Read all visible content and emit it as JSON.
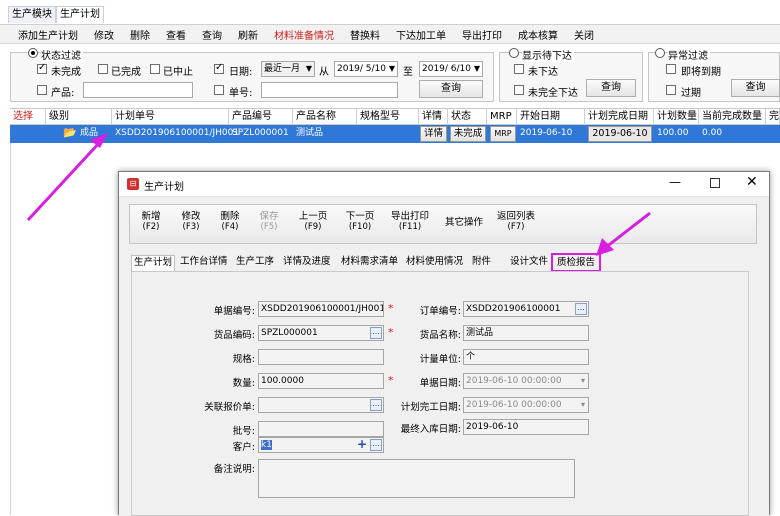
{
  "tabs": [
    "生产模块",
    "生产计划"
  ],
  "toolbar": [
    "添加生产计划",
    "修改",
    "删除",
    "查看",
    "查询",
    "刷新",
    "材料准备情况",
    "替换料",
    "下达加工单",
    "导出打印",
    "成本核算",
    "关闭"
  ],
  "colors": {
    "red_label": "#d0201e",
    "selected_row": "#2f78d7",
    "highlight": "#d81ee0"
  },
  "filter1": {
    "title": "状态过滤",
    "unfinished": "未完成",
    "finished": "已完成",
    "stopped": "已中止",
    "date_label": "日期:",
    "date_range": "最近一月",
    "from_label": "从",
    "from_date": "2019/ 5/10",
    "to_label": "至",
    "to_date": "2019/ 6/10",
    "product_label": "产品:",
    "order_label": "单号:",
    "query": "查询"
  },
  "filter2": {
    "title": "显示待下达",
    "not_issued": "未下达",
    "not_fully_issued": "未完全下达",
    "query": "查询"
  },
  "filter3": {
    "title": "异常过滤",
    "due_soon": "即将到期",
    "overdue": "过期",
    "query": "查询"
  },
  "grid": {
    "headers": [
      "选择",
      "级别",
      "计划单号",
      "产品编号",
      "产品名称",
      "规格型号",
      "详情",
      "状态",
      "MRP",
      "开始日期",
      "计划完成日期",
      "计划数量",
      "当前完成数量",
      "完"
    ],
    "row": {
      "level": "成品",
      "plan_no": "XSDD201906100001/JH001",
      "product_no": "SPZL000001",
      "product_name": "测试品",
      "detail": "详情",
      "status": "未完成",
      "mrp": "MRP",
      "start_date": "2019-06-10",
      "plan_finish_date": "2019-06-10",
      "plan_qty": "100.00",
      "current_qty": "0.00"
    }
  },
  "dialog": {
    "title": "生产计划",
    "tools": [
      {
        "label": "新增",
        "key": "(F2)"
      },
      {
        "label": "修改",
        "key": "(F3)"
      },
      {
        "label": "删除",
        "key": "(F4)"
      },
      {
        "label": "保存",
        "key": "(F5)"
      },
      {
        "label": "上一页",
        "key": "(F9)"
      },
      {
        "label": "下一页",
        "key": "(F10)"
      },
      {
        "label": "导出打印",
        "key": "(F11)"
      },
      {
        "label": "其它操作",
        "key": ""
      },
      {
        "label": "返回列表",
        "key": "(F7)"
      }
    ],
    "tabs": [
      "生产计划",
      "工作台详情",
      "生产工序",
      "详情及进度",
      "材料需求清单",
      "材料使用情况",
      "附件",
      "设计文件",
      "质检报告"
    ],
    "form": {
      "doc_no_label": "单据编号:",
      "doc_no": "XSDD201906100001/JH001",
      "order_no_label": "订单编号:",
      "order_no": "XSDD201906100001",
      "item_code_label": "货品编码:",
      "item_code": "SPZL000001",
      "item_name_label": "货品名称:",
      "item_name": "测试品",
      "spec_label": "规格:",
      "unit_label": "计量单位:",
      "unit": "个",
      "qty_label": "数量:",
      "qty": "100.0000",
      "doc_date_label": "单据日期:",
      "doc_date": "2019-06-10 00:00:00",
      "link_quote_label": "关联报价单:",
      "plan_finish_label": "计划完工日期:",
      "plan_finish": "2019-06-10 00:00:00",
      "batch_label": "批号:",
      "latest_in_label": "最终入库日期:",
      "latest_in": "2019-06-10",
      "customer_label": "客户:",
      "customer": "k1",
      "remark_label": "备注说明:"
    }
  }
}
